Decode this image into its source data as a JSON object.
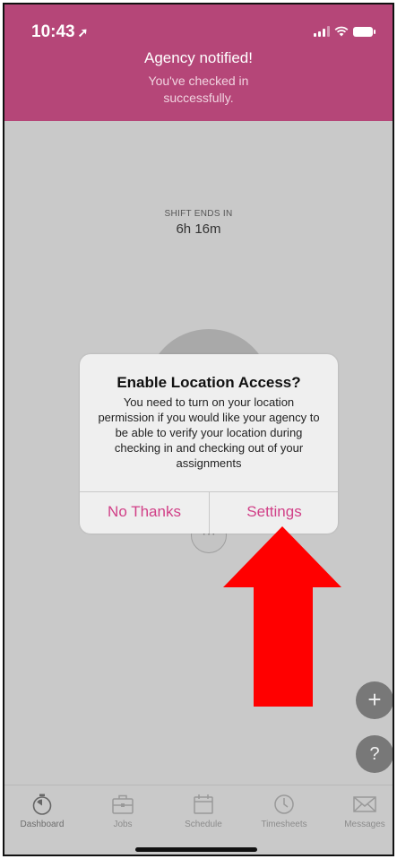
{
  "status_bar": {
    "time": "10:43",
    "location_arrow": "➚"
  },
  "banner": {
    "title": "Agency notified!",
    "subtitle_line1": "You've checked in",
    "subtitle_line2": "successfully."
  },
  "shift": {
    "label": "SHIFT ENDS IN",
    "value": "6h 16m"
  },
  "dialog": {
    "title": "Enable Location Access?",
    "message": "You need to turn on your location permission if you would like your agency to be able to verify your location during checking in and checking out of your assignments",
    "no_label": "No Thanks",
    "settings_label": "Settings"
  },
  "small_circle_text": "···",
  "fabs": {
    "plus": "+",
    "help": "?"
  },
  "tabs": [
    {
      "label": "Dashboard",
      "icon": "stopwatch-icon"
    },
    {
      "label": "Jobs",
      "icon": "briefcase-icon"
    },
    {
      "label": "Schedule",
      "icon": "calendar-icon"
    },
    {
      "label": "Timesheets",
      "icon": "clock-icon"
    },
    {
      "label": "Messages",
      "icon": "envelope-icon"
    }
  ],
  "colors": {
    "brand": "#b54678",
    "dialog_button": "#d13f87",
    "arrow": "#ff0000",
    "overlay": "#c9c9c9"
  }
}
